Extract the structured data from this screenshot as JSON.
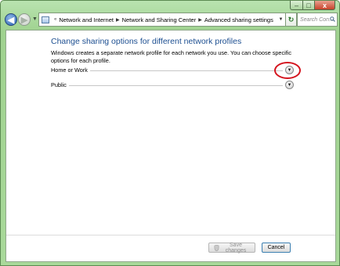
{
  "window": {
    "caption_minimize": "–",
    "caption_maximize": "□",
    "caption_close": "x"
  },
  "navigation": {
    "back_glyph": "◀",
    "forward_glyph": "▶",
    "dropdown_glyph": "▼",
    "breadcrumb": [
      "Network and Internet",
      "Network and Sharing Center",
      "Advanced sharing settings"
    ],
    "breadcrumb_sep": "▶",
    "root_sep": "«",
    "refresh_glyph": "↻",
    "search_placeholder": "Search Con..."
  },
  "main": {
    "heading": "Change sharing options for different network profiles",
    "description": "Windows creates a separate network profile for each network you use. You can choose specific options for each profile.",
    "profiles": [
      {
        "label": "Home or Work",
        "expand_glyph": "▼",
        "highlighted": true
      },
      {
        "label": "Public",
        "expand_glyph": "▼",
        "highlighted": false
      }
    ]
  },
  "footer": {
    "save_label": "Save changes",
    "cancel_label": "Cancel"
  },
  "colors": {
    "frame": "#a9d99a",
    "heading": "#1d4f91",
    "highlight_ring": "#d4141e"
  },
  "icons": [
    "back-icon",
    "forward-icon",
    "network-icon",
    "refresh-icon",
    "search-icon",
    "chevron-down-icon",
    "shield-icon"
  ]
}
